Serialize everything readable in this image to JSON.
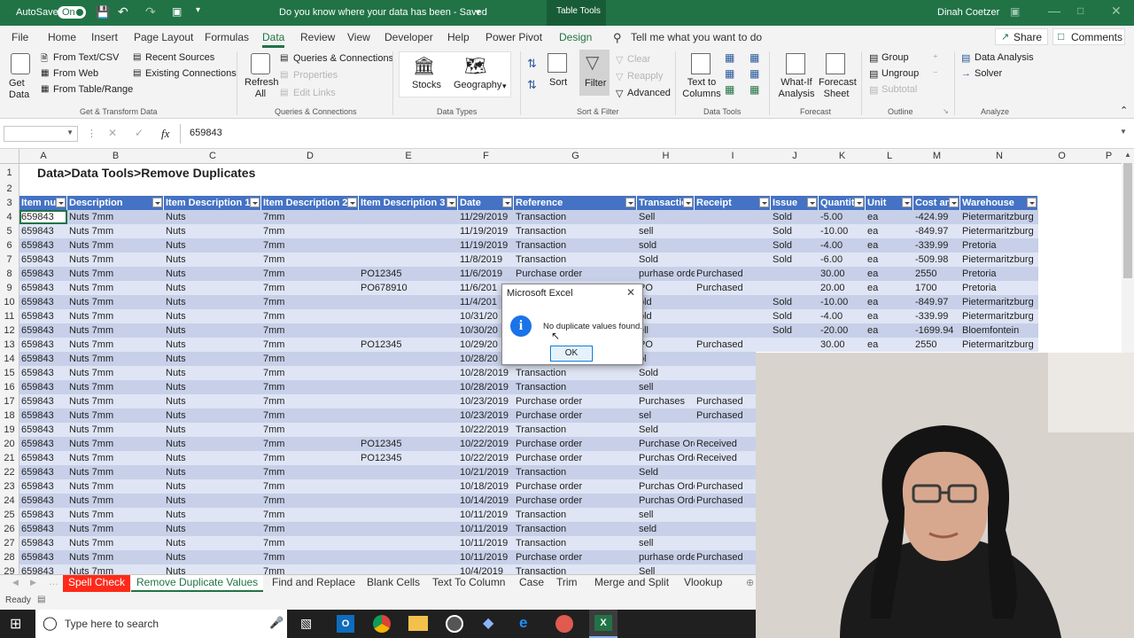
{
  "titlebar": {
    "autosave": "AutoSave",
    "toggle": "On",
    "title": "Do you know where your data has been  -  Saved",
    "contextual": "Table Tools",
    "user": "Dinah Coetzer"
  },
  "tabs": [
    "File",
    "Home",
    "Insert",
    "Page Layout",
    "Formulas",
    "Data",
    "Review",
    "View",
    "Developer",
    "Help",
    "Power Pivot",
    "Design"
  ],
  "active_tab": "Data",
  "tell_me": "Tell me what you want to do",
  "share": "Share",
  "comments": "Comments",
  "ribbon": {
    "get_data": "Get Data",
    "from_text": "From Text/CSV",
    "from_web": "From Web",
    "from_table": "From Table/Range",
    "recent_sources": "Recent Sources",
    "existing_connections": "Existing Connections",
    "g_get_transform": "Get & Transform Data",
    "refresh_all": "Refresh All",
    "queries_connections": "Queries & Connections",
    "properties": "Properties",
    "edit_links": "Edit Links",
    "g_queries": "Queries & Connections",
    "stocks": "Stocks",
    "geography": "Geography",
    "g_datatypes": "Data Types",
    "sort": "Sort",
    "filter": "Filter",
    "clear": "Clear",
    "reapply": "Reapply",
    "advanced": "Advanced",
    "g_sortfilter": "Sort & Filter",
    "text_to_columns": "Text to Columns",
    "g_datatools": "Data Tools",
    "what_if": "What-If Analysis",
    "forecast_sheet": "Forecast Sheet",
    "g_forecast": "Forecast",
    "group": "Group",
    "ungroup": "Ungroup",
    "subtotal": "Subtotal",
    "g_outline": "Outline",
    "data_analysis": "Data Analysis",
    "solver": "Solver",
    "g_analyze": "Analyze"
  },
  "formula": {
    "fx": "fx",
    "value": "659843"
  },
  "columns": [
    "A",
    "B",
    "C",
    "D",
    "E",
    "F",
    "G",
    "H",
    "I",
    "J",
    "K",
    "L",
    "M",
    "N",
    "O",
    "P"
  ],
  "sheet_title": "Data>Data Tools>Remove Duplicates",
  "table_headers": [
    "Item nu",
    "Description",
    "Item Description 1",
    "Item Description 2",
    "Item Description 3",
    "Date",
    "Reference",
    "Transactio",
    "Receipt",
    "Issue",
    "Quantit",
    "Unit",
    "Cost an",
    "Warehouse"
  ],
  "rows": [
    {
      "n": "4",
      "c": [
        "659843",
        "Nuts 7mm",
        "Nuts",
        "7mm",
        "",
        "11/29/2019",
        "Transaction",
        "Sell",
        "",
        "Sold",
        "-5.00",
        "ea",
        "-424.99",
        "Pietermaritzburg"
      ]
    },
    {
      "n": "5",
      "c": [
        "659843",
        "Nuts 7mm",
        "Nuts",
        "7mm",
        "",
        "11/19/2019",
        "Transaction",
        "sell",
        "",
        "Sold",
        "-10.00",
        "ea",
        "-849.97",
        "Pietermaritzburg"
      ]
    },
    {
      "n": "6",
      "c": [
        "659843",
        "Nuts 7mm",
        "Nuts",
        "7mm",
        "",
        "11/19/2019",
        "Transaction",
        "sold",
        "",
        "Sold",
        "-4.00",
        "ea",
        "-339.99",
        "Pretoria"
      ]
    },
    {
      "n": "7",
      "c": [
        "659843",
        "Nuts 7mm",
        "Nuts",
        "7mm",
        "",
        "11/8/2019",
        "Transaction",
        "Sold",
        "",
        "Sold",
        "-6.00",
        "ea",
        "-509.98",
        "Pietermaritzburg"
      ]
    },
    {
      "n": "8",
      "c": [
        "659843",
        "Nuts 7mm",
        "Nuts",
        "7mm",
        "PO12345",
        "11/6/2019",
        "Purchase order",
        "purhase orde",
        "Purchased",
        "",
        "30.00",
        "ea",
        "2550",
        "Pretoria"
      ]
    },
    {
      "n": "9",
      "c": [
        "659843",
        "Nuts 7mm",
        "Nuts",
        "7mm",
        "PO678910",
        "11/6/201",
        "",
        "PO",
        "Purchased",
        "",
        "20.00",
        "ea",
        "1700",
        "Pretoria"
      ]
    },
    {
      "n": "10",
      "c": [
        "659843",
        "Nuts 7mm",
        "Nuts",
        "7mm",
        "",
        "11/4/201",
        "",
        "old",
        "",
        "Sold",
        "-10.00",
        "ea",
        "-849.97",
        "Pietermaritzburg"
      ]
    },
    {
      "n": "11",
      "c": [
        "659843",
        "Nuts 7mm",
        "Nuts",
        "7mm",
        "",
        "10/31/20",
        "",
        "old",
        "",
        "Sold",
        "-4.00",
        "ea",
        "-339.99",
        "Pietermaritzburg"
      ]
    },
    {
      "n": "12",
      "c": [
        "659843",
        "Nuts 7mm",
        "Nuts",
        "7mm",
        "",
        "10/30/20",
        "",
        "ell",
        "",
        "Sold",
        "-20.00",
        "ea",
        "-1699.94",
        "Bloemfontein"
      ]
    },
    {
      "n": "13",
      "c": [
        "659843",
        "Nuts 7mm",
        "Nuts",
        "7mm",
        "PO12345",
        "10/29/20",
        "",
        "PO",
        "Purchased",
        "",
        "30.00",
        "ea",
        "2550",
        "Pietermaritzburg"
      ]
    },
    {
      "n": "14",
      "c": [
        "659843",
        "Nuts 7mm",
        "Nuts",
        "7mm",
        "",
        "10/28/20",
        "",
        "ol",
        "",
        "",
        "",
        "",
        "",
        ""
      ]
    },
    {
      "n": "15",
      "c": [
        "659843",
        "Nuts 7mm",
        "Nuts",
        "7mm",
        "",
        "10/28/2019",
        "Transaction",
        "Sold",
        "",
        "",
        "",
        "",
        "",
        ""
      ]
    },
    {
      "n": "16",
      "c": [
        "659843",
        "Nuts 7mm",
        "Nuts",
        "7mm",
        "",
        "10/28/2019",
        "Transaction",
        "sell",
        "",
        "",
        "",
        "",
        "",
        ""
      ]
    },
    {
      "n": "17",
      "c": [
        "659843",
        "Nuts 7mm",
        "Nuts",
        "7mm",
        "",
        "10/23/2019",
        "Purchase order",
        "Purchases",
        "Purchased",
        "",
        "",
        "",
        "",
        ""
      ]
    },
    {
      "n": "18",
      "c": [
        "659843",
        "Nuts 7mm",
        "Nuts",
        "7mm",
        "",
        "10/23/2019",
        "Purchase order",
        "sel",
        "Purchased",
        "",
        "",
        "",
        "",
        ""
      ]
    },
    {
      "n": "19",
      "c": [
        "659843",
        "Nuts 7mm",
        "Nuts",
        "7mm",
        "",
        "10/22/2019",
        "Transaction",
        "Seld",
        "",
        "",
        "",
        "",
        "",
        ""
      ]
    },
    {
      "n": "20",
      "c": [
        "659843",
        "Nuts 7mm",
        "Nuts",
        "7mm",
        "PO12345",
        "10/22/2019",
        "Purchase order",
        "Purchase Ord",
        "Received",
        "",
        "",
        "",
        "",
        ""
      ]
    },
    {
      "n": "21",
      "c": [
        "659843",
        "Nuts 7mm",
        "Nuts",
        "7mm",
        "PO12345",
        "10/22/2019",
        "Purchase order",
        "Purchas Orde",
        "Received",
        "",
        "",
        "",
        "",
        ""
      ]
    },
    {
      "n": "22",
      "c": [
        "659843",
        "Nuts 7mm",
        "Nuts",
        "7mm",
        "",
        "10/21/2019",
        "Transaction",
        "Seld",
        "",
        "",
        "",
        "",
        "",
        ""
      ]
    },
    {
      "n": "23",
      "c": [
        "659843",
        "Nuts 7mm",
        "Nuts",
        "7mm",
        "",
        "10/18/2019",
        "Purchase order",
        "Purchas Orde",
        "Purchased",
        "",
        "",
        "",
        "",
        ""
      ]
    },
    {
      "n": "24",
      "c": [
        "659843",
        "Nuts 7mm",
        "Nuts",
        "7mm",
        "",
        "10/14/2019",
        "Purchase order",
        "Purchas Orde",
        "Purchased",
        "",
        "",
        "",
        "",
        ""
      ]
    },
    {
      "n": "25",
      "c": [
        "659843",
        "Nuts 7mm",
        "Nuts",
        "7mm",
        "",
        "10/11/2019",
        "Transaction",
        "sell",
        "",
        "",
        "",
        "",
        "",
        ""
      ]
    },
    {
      "n": "26",
      "c": [
        "659843",
        "Nuts 7mm",
        "Nuts",
        "7mm",
        "",
        "10/11/2019",
        "Transaction",
        "seld",
        "",
        "",
        "",
        "",
        "",
        ""
      ]
    },
    {
      "n": "27",
      "c": [
        "659843",
        "Nuts 7mm",
        "Nuts",
        "7mm",
        "",
        "10/11/2019",
        "Transaction",
        "sell",
        "",
        "",
        "",
        "",
        "",
        ""
      ]
    },
    {
      "n": "28",
      "c": [
        "659843",
        "Nuts 7mm",
        "Nuts",
        "7mm",
        "",
        "10/11/2019",
        "Purchase order",
        "purhase orde",
        "Purchased",
        "",
        "",
        "",
        "",
        ""
      ]
    },
    {
      "n": "29",
      "c": [
        "659843",
        "Nuts 7mm",
        "Nuts",
        "7mm",
        "",
        "10/4/2019",
        "Transaction",
        "Sell",
        "",
        "",
        "",
        "",
        "",
        ""
      ]
    }
  ],
  "sheet_tabs": [
    "Spell Check",
    "Remove Duplicate Values",
    "Find and Replace",
    "Blank Cells",
    "Text To Column",
    "Case",
    "Trim",
    "Merge and Split",
    "Vlookup"
  ],
  "active_sheet": "Remove Duplicate Values",
  "status": "Ready",
  "taskbar": {
    "search": "Type here to search"
  },
  "dialog": {
    "title": "Microsoft Excel",
    "message": "No duplicate values found.",
    "ok": "OK"
  }
}
